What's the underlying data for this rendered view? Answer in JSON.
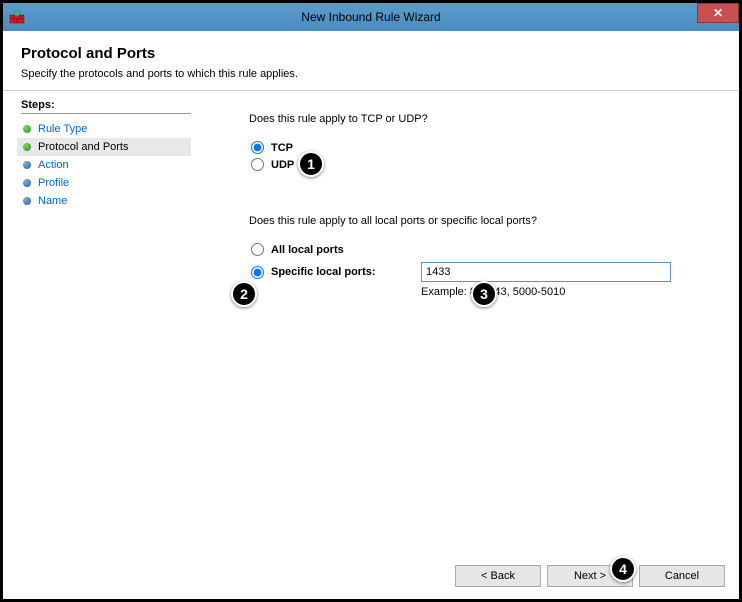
{
  "window": {
    "title": "New Inbound Rule Wizard"
  },
  "header": {
    "title": "Protocol and Ports",
    "description": "Specify the protocols and ports to which this rule applies."
  },
  "sidebar": {
    "label": "Steps:",
    "items": [
      {
        "label": "Rule Type"
      },
      {
        "label": "Protocol and Ports"
      },
      {
        "label": "Action"
      },
      {
        "label": "Profile"
      },
      {
        "label": "Name"
      }
    ]
  },
  "panel": {
    "q1": "Does this rule apply to TCP or UDP?",
    "tcp": "TCP",
    "udp": "UDP",
    "q2": "Does this rule apply to all local ports or specific local ports?",
    "all_ports": "All local ports",
    "specific_ports": "Specific local ports:",
    "ports_value": "1433",
    "example": "Example: 80, 443, 5000-5010"
  },
  "buttons": {
    "back": "< Back",
    "next": "Next >",
    "cancel": "Cancel"
  },
  "callouts": {
    "c1": "1",
    "c2": "2",
    "c3": "3",
    "c4": "4"
  }
}
